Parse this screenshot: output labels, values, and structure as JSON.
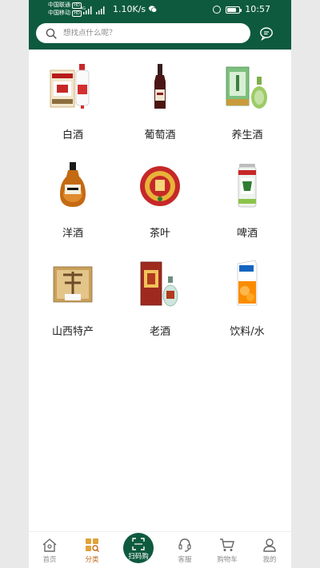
{
  "status_bar": {
    "carrier_1": "中国联通",
    "carrier_2": "中国移动",
    "carrier_1_badge": "HD",
    "carrier_2_badge": "HD",
    "net_type": "4G",
    "net_speed": "1.10K/s",
    "time": "10:57",
    "battery_level": 0.8
  },
  "search": {
    "placeholder": "想找点什么呢？",
    "value": ""
  },
  "categories": [
    {
      "label": "白酒",
      "icon": "baijiu-bottle-icon"
    },
    {
      "label": "葡萄酒",
      "icon": "wine-bottle-icon"
    },
    {
      "label": "养生酒",
      "icon": "health-wine-icon"
    },
    {
      "label": "洋酒",
      "icon": "cognac-bottle-icon"
    },
    {
      "label": "茶叶",
      "icon": "tea-cake-icon"
    },
    {
      "label": "啤酒",
      "icon": "beer-can-icon"
    },
    {
      "label": "山西特产",
      "icon": "local-specialty-icon"
    },
    {
      "label": "老酒",
      "icon": "aged-liquor-icon"
    },
    {
      "label": "饮料/水",
      "icon": "juice-carton-icon"
    }
  ],
  "tabs": [
    {
      "label": "首页",
      "icon": "home-icon"
    },
    {
      "label": "分类",
      "icon": "category-icon",
      "active": true
    },
    {
      "label": "扫码购",
      "icon": "scan-icon"
    },
    {
      "label": "客服",
      "icon": "headset-icon"
    },
    {
      "label": "购物车",
      "icon": "cart-icon"
    },
    {
      "label": "我的",
      "icon": "user-icon"
    }
  ],
  "colors": {
    "header": "#0e5a3f",
    "active_tab": "#c06a1a",
    "text": "#222222"
  }
}
